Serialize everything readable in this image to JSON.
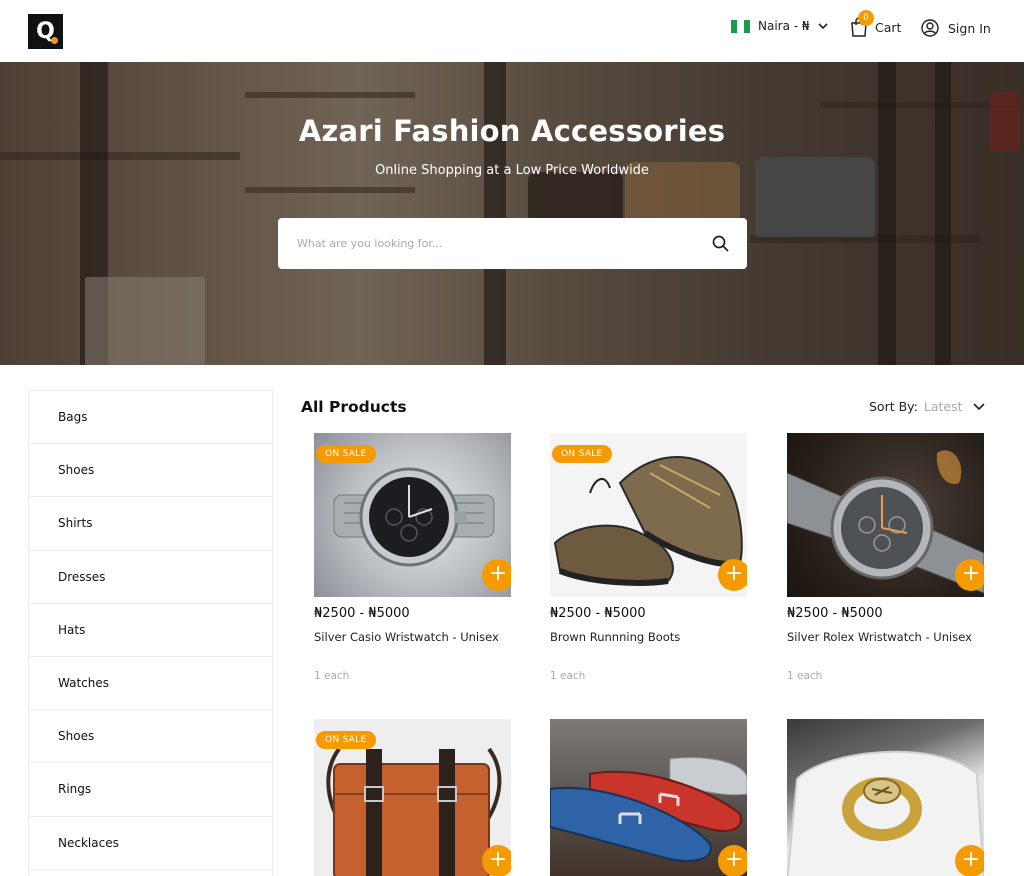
{
  "header": {
    "logo_letter": "Q",
    "currency_label": "Naira - ₦",
    "cart_label": "Cart",
    "cart_count": "0",
    "signin_label": "Sign In"
  },
  "hero": {
    "title": "Azari Fashion Accessories",
    "subtitle": "Online Shopping at a Low Price Worldwide",
    "search_placeholder": "What are you looking for..."
  },
  "sidebar": {
    "items": [
      {
        "label": "Bags"
      },
      {
        "label": "Shoes"
      },
      {
        "label": "Shirts"
      },
      {
        "label": "Dresses"
      },
      {
        "label": "Hats"
      },
      {
        "label": "Watches"
      },
      {
        "label": "Shoes"
      },
      {
        "label": "Rings"
      },
      {
        "label": "Necklaces"
      }
    ]
  },
  "products": {
    "title": "All Products",
    "sort_label": "Sort By:",
    "sort_value": "Latest",
    "sale_label": "ON SALE",
    "add_symbol": "+",
    "items": [
      {
        "price": "₦2500 - ₦5000",
        "name": "Silver Casio Wristwatch - Unisex",
        "unit": "1 each",
        "on_sale": true
      },
      {
        "price": "₦2500 - ₦5000",
        "name": "Brown Runnning Boots",
        "unit": "1 each",
        "on_sale": true
      },
      {
        "price": "₦2500 - ₦5000",
        "name": "Silver Rolex Wristwatch - Unisex",
        "unit": "1 each",
        "on_sale": false
      },
      {
        "on_sale": true
      },
      {
        "on_sale": false
      },
      {
        "on_sale": false
      }
    ]
  },
  "colors": {
    "accent": "#f59b00",
    "flag_green": "#1a9a4b"
  }
}
